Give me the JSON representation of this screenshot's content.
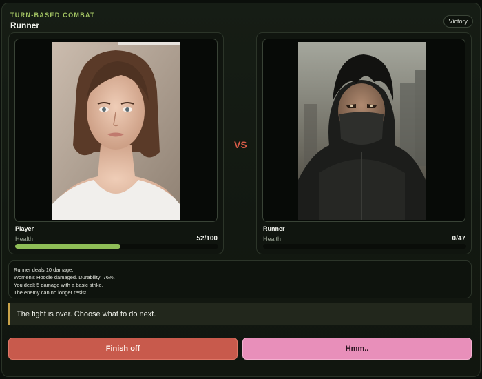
{
  "header": {
    "kicker": "TURN-BASED COMBAT",
    "title": "Runner",
    "status": "Victory"
  },
  "player": {
    "name": "Player",
    "health_label": "Health",
    "health_text": "52/100",
    "health_fraction": 0.52,
    "bar_color": "#8fbe57"
  },
  "enemy": {
    "name": "Runner",
    "health_label": "Health",
    "health_text": "0/47",
    "health_fraction": 0
  },
  "versus_label": "VS",
  "combat_log": [
    "Runner deals 10 damage.",
    "Women's Hoodie damaged. Durability: 76%.",
    "You dealt 5 damage with a basic strike.",
    "The enemy can no longer resist."
  ],
  "notice": "The fight is over. Choose what to do next.",
  "actions": {
    "finish_label": "Finish off",
    "hmm_label": "Hmm.."
  },
  "colors": {
    "accent": "#a3c463",
    "vs": "#d85b48",
    "finish_button": "#c85a4c",
    "hmm_button": "#e88fba",
    "notice_border": "#c9a24a"
  }
}
